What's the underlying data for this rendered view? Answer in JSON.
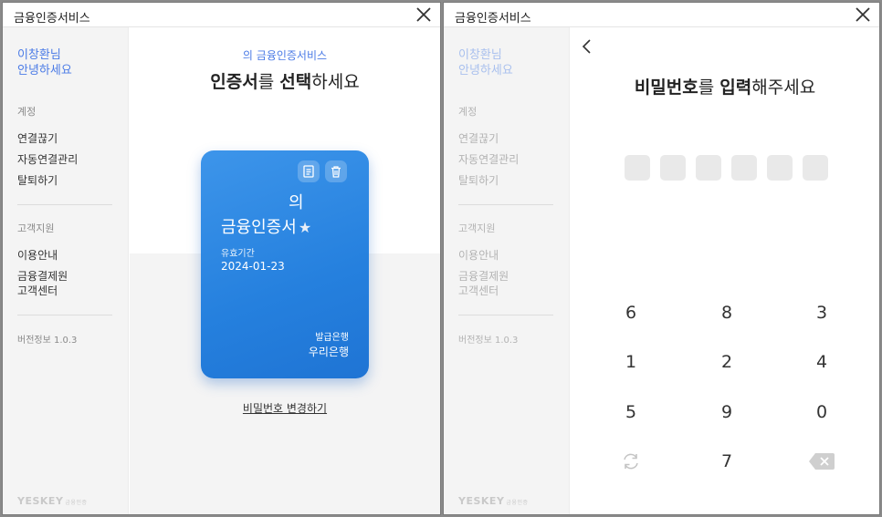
{
  "left_window": {
    "title": "금융인증서비스",
    "sidebar": {
      "greeting_name": "이창환님",
      "greeting_text": "안녕하세요",
      "account_label": "계정",
      "account_items": [
        "연결끊기",
        "자동연결관리",
        "탈퇴하기"
      ],
      "support_label": "고객지원",
      "support_items": [
        "이용안내",
        "금융결제원",
        "고객센터"
      ],
      "version": "버전정보 1.0.3",
      "logo": "YESKEY",
      "logo_sub": "금융인증"
    },
    "main": {
      "service_subtitle": "의 금융인증서비스",
      "heading_bold_1": "인증서",
      "heading_mid": "를 ",
      "heading_bold_2": "선택",
      "heading_end": "하세요",
      "card": {
        "name_line1": "의",
        "name_line2": "금융인증서",
        "star": "★",
        "expiry_label": "유효기간",
        "expiry_date": "2024-01-23",
        "issuer_label": "발급은행",
        "issuer": "우리은행"
      },
      "change_password": "비밀번호 변경하기"
    }
  },
  "right_window": {
    "title": "금융인증서비스",
    "heading_bold_1": "비밀번호",
    "heading_mid": "를 ",
    "heading_bold_2": "입력",
    "heading_end": "해주세요",
    "pin_length": 6,
    "keypad": [
      "6",
      "8",
      "3",
      "1",
      "2",
      "4",
      "5",
      "9",
      "0",
      "",
      "7",
      ""
    ],
    "keypad_icons": {
      "shuffle": "refresh-icon",
      "delete": "backspace-icon"
    }
  },
  "colors": {
    "accent": "#4b7be6",
    "card": "#2580de"
  }
}
